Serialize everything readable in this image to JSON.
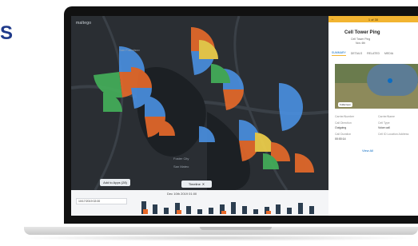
{
  "brand": {
    "glyph": "S"
  },
  "app": {
    "logo_text": "maltego",
    "map_labels": {
      "bay_area": "San Francisco",
      "south": "Foster City",
      "south2": "San Mateo"
    },
    "add_button_label": "Add to Apps (28)",
    "timeline_button_label": "Timeline"
  },
  "timeline": {
    "date_input_value": "10/17/2019 02:00",
    "title": "Dec 10th 2019 01:00"
  },
  "panel": {
    "topbar_text": "1 of 30",
    "title": "Cell Tower Ping",
    "subtitle_1": "Cell Tower Ping",
    "subtitle_2": "Nov 4th",
    "tabs": [
      "SUMMARY",
      "DETAILS",
      "RELATED",
      "MEDIA"
    ],
    "active_tab_index": 0,
    "map_button_label": "Fullscreen",
    "fields": {
      "left": [
        {
          "label": "Carrier/Number",
          "value": ""
        },
        {
          "label": "Call Direction",
          "value": "Outgoing"
        },
        {
          "label": "Call Duration",
          "value": "00:00:14"
        }
      ],
      "right": [
        {
          "label": "Carrier/Name",
          "value": ""
        },
        {
          "label": "Cell Type",
          "value": "Voice call"
        },
        {
          "label": "Cell ID Location Address",
          "value": ""
        }
      ]
    },
    "view_all_label": "View All"
  },
  "colors": {
    "accent_yellow": "#f2b431",
    "blue": "#4a90e2",
    "orange": "#e86a2a",
    "green": "#44b15a",
    "yellow": "#f3d34b",
    "dark_bg": "#2a2e33"
  }
}
